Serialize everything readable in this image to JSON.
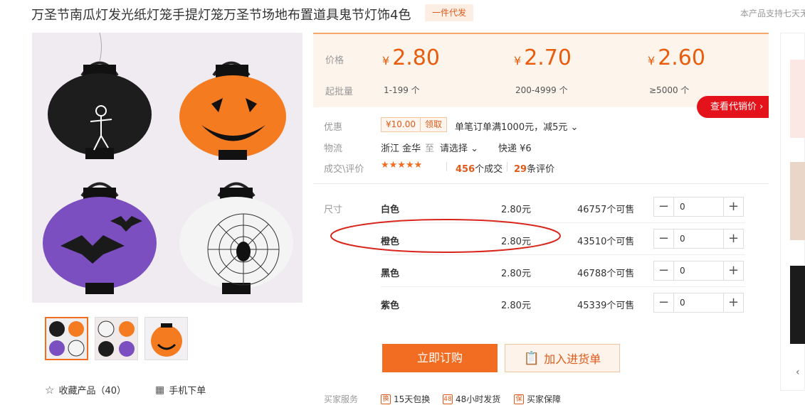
{
  "title": "万圣节南瓜灯发光纸灯笼手提灯笼万圣节场地布置道具鬼节灯饰4色",
  "badge": "一件代发",
  "support_text": "本产品支持七天无",
  "price_label": "价格",
  "moq_label": "起批量",
  "prices": [
    {
      "currency": "¥",
      "value": "2.80",
      "qty": "1-199 个"
    },
    {
      "currency": "¥",
      "value": "2.70",
      "qty": "200-4999 个"
    },
    {
      "currency": "¥",
      "value": "2.60",
      "qty": "≥5000 个"
    }
  ],
  "agent_price_button": "查看代销价 ›",
  "promo": {
    "label": "优惠",
    "coupon_amount": "¥10.00",
    "coupon_claim": "领取",
    "text": "单笔订单满1000元，减5元 ⌄"
  },
  "logistics": {
    "label": "物流",
    "origin": "浙江 金华",
    "to": "至",
    "destination": "请选择 ⌄",
    "shipping": "快递 ¥6"
  },
  "reviews": {
    "label": "成交\\评价",
    "stars": "★★★★★",
    "rating": 4.5,
    "deals_count": "456",
    "deals_text": "个成交",
    "review_count": "29",
    "review_text": "条评价"
  },
  "sku": {
    "label": "尺寸",
    "rows": [
      {
        "name": "白色",
        "price": "2.80元",
        "stock": "46757个可售",
        "qty": "0"
      },
      {
        "name": "橙色",
        "price": "2.80元",
        "stock": "43510个可售",
        "qty": "0"
      },
      {
        "name": "黑色",
        "price": "2.80元",
        "stock": "46788个可售",
        "qty": "0"
      },
      {
        "name": "紫色",
        "price": "2.80元",
        "stock": "45339个可售",
        "qty": "0"
      }
    ]
  },
  "buy_now": "立即订购",
  "add_to_cart": "加入进货单",
  "favorite": "收藏产品（40）",
  "mobile_order": "手机下单",
  "services": {
    "label": "买家服务",
    "items": [
      "15天包换",
      "48小时发货",
      "买家保障"
    ]
  },
  "colors": {
    "accent": "#f26c21",
    "red": "#e4131b",
    "price": "#e85c0c"
  }
}
